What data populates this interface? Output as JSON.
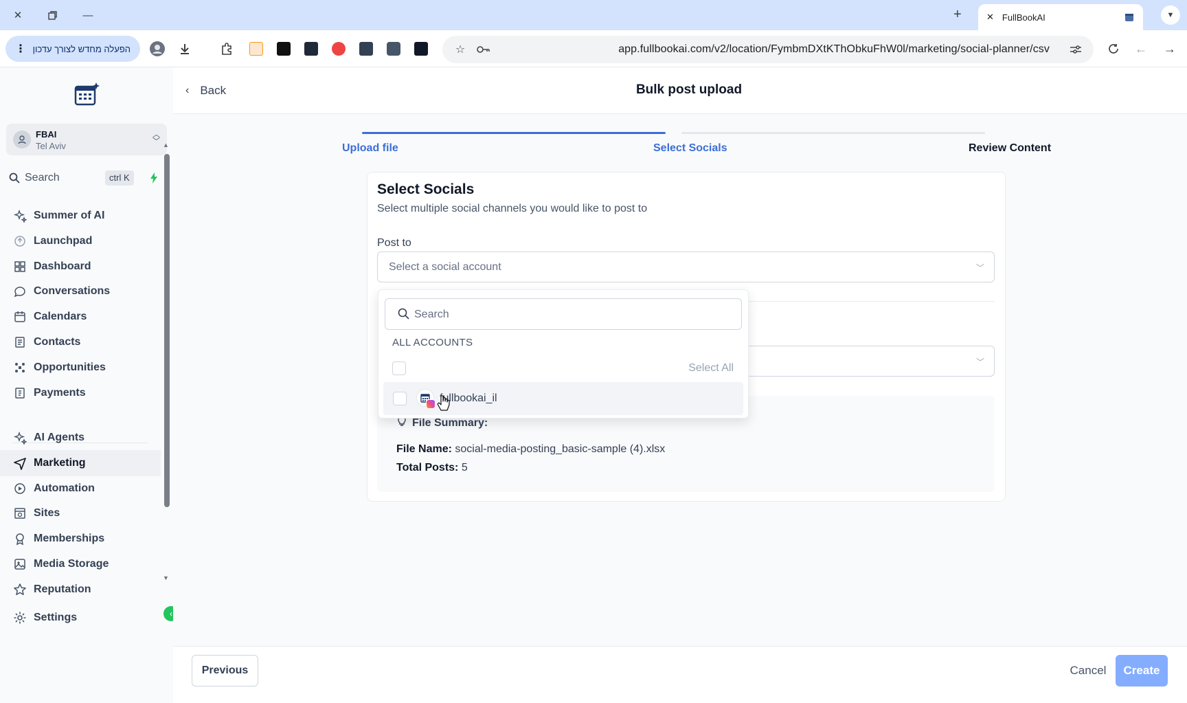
{
  "browser": {
    "tab_title": "FullBookAI",
    "update_button": "הפעלה מחדש לצורך עדכון",
    "url": "app.fullbookai.com/v2/location/FymbmDXtKThObkuFhW0l/marketing/social-planner/csv"
  },
  "sidebar": {
    "account_name": "FBAI",
    "account_location": "Tel Aviv",
    "search_label": "Search",
    "search_shortcut": "ctrl K",
    "items": [
      {
        "label": "Summer of AI",
        "icon": "sparkles-icon"
      },
      {
        "label": "Launchpad",
        "icon": "rocket-icon"
      },
      {
        "label": "Dashboard",
        "icon": "grid-icon"
      },
      {
        "label": "Conversations",
        "icon": "chat-icon"
      },
      {
        "label": "Calendars",
        "icon": "calendar-icon"
      },
      {
        "label": "Contacts",
        "icon": "contacts-icon"
      },
      {
        "label": "Opportunities",
        "icon": "opportunities-icon"
      },
      {
        "label": "Payments",
        "icon": "payments-icon"
      }
    ],
    "items2": [
      {
        "label": "AI Agents",
        "icon": "sparkles-icon"
      },
      {
        "label": "Marketing",
        "icon": "send-icon",
        "active": true
      },
      {
        "label": "Automation",
        "icon": "automation-icon"
      },
      {
        "label": "Sites",
        "icon": "sites-icon"
      },
      {
        "label": "Memberships",
        "icon": "memberships-icon"
      },
      {
        "label": "Media Storage",
        "icon": "image-icon"
      },
      {
        "label": "Reputation",
        "icon": "star-icon"
      }
    ],
    "settings_label": "Settings"
  },
  "header": {
    "back_label": "Back",
    "title": "Bulk post upload"
  },
  "steps": [
    {
      "label": "Upload file",
      "state": "done"
    },
    {
      "label": "Select Socials",
      "state": "current"
    },
    {
      "label": "Review Content",
      "state": "pending"
    }
  ],
  "card": {
    "title": "Select Socials",
    "subtitle": "Select multiple social channels you would like to post to",
    "post_to_label": "Post to",
    "select_placeholder": "Select a social account"
  },
  "dropdown": {
    "search_placeholder": "Search",
    "section_label": "ALL ACCOUNTS",
    "select_all_label": "Select All",
    "accounts": [
      {
        "handle": "fullbookai_il",
        "network": "instagram"
      }
    ]
  },
  "summary": {
    "heading": "File Summary:",
    "file_name_label": "File Name:",
    "file_name": "social-media-posting_basic-sample (4).xlsx",
    "total_posts_label": "Total Posts:",
    "total_posts": "5"
  },
  "footer": {
    "previous_label": "Previous",
    "cancel_label": "Cancel",
    "create_label": "Create"
  },
  "colors": {
    "accent": "#2563eb",
    "step_done": "#3b6fd8",
    "create_disabled": "#84adff",
    "active_badge": "#22c55e"
  }
}
